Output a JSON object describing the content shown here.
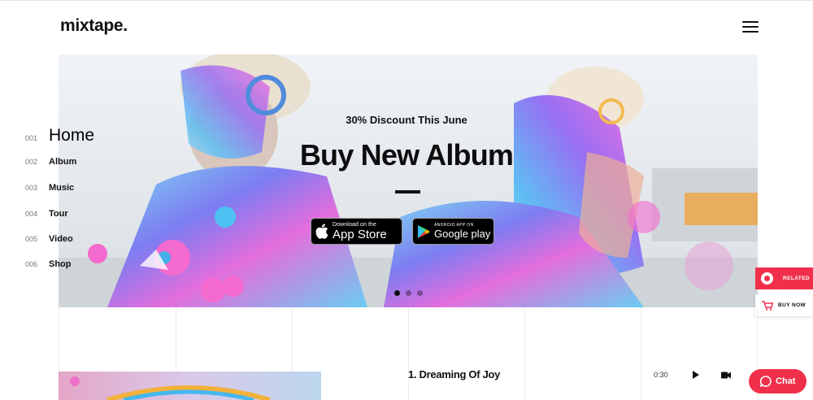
{
  "header": {
    "logo": "mixtape.",
    "menu_icon": "hamburger-icon"
  },
  "hero": {
    "discount": "30% Discount This June",
    "headline": "Buy New Album",
    "app_store": {
      "small": "Download on the",
      "big": "App Store",
      "icon": "apple-icon"
    },
    "google_play": {
      "small": "ANDROID APP ON",
      "big": "Google play",
      "icon": "google-play-icon"
    },
    "slides_total": 3,
    "slide_active": 1
  },
  "side_nav": {
    "items": [
      {
        "num": "001",
        "label": "Home",
        "active": true
      },
      {
        "num": "002",
        "label": "Album"
      },
      {
        "num": "003",
        "label": "Music"
      },
      {
        "num": "004",
        "label": "Tour"
      },
      {
        "num": "005",
        "label": "Video"
      },
      {
        "num": "006",
        "label": "Shop"
      }
    ]
  },
  "floating": {
    "related": "RELATED",
    "buy_now": "BUY NOW"
  },
  "track": {
    "title": "1. Dreaming Of Joy",
    "time": "0:30",
    "play_icon": "play-icon",
    "video_icon": "video-camera-icon"
  },
  "chat": {
    "label": "Chat",
    "icon": "chat-bubble-icon"
  },
  "colors": {
    "accent": "#f0304a",
    "text": "#111111"
  }
}
